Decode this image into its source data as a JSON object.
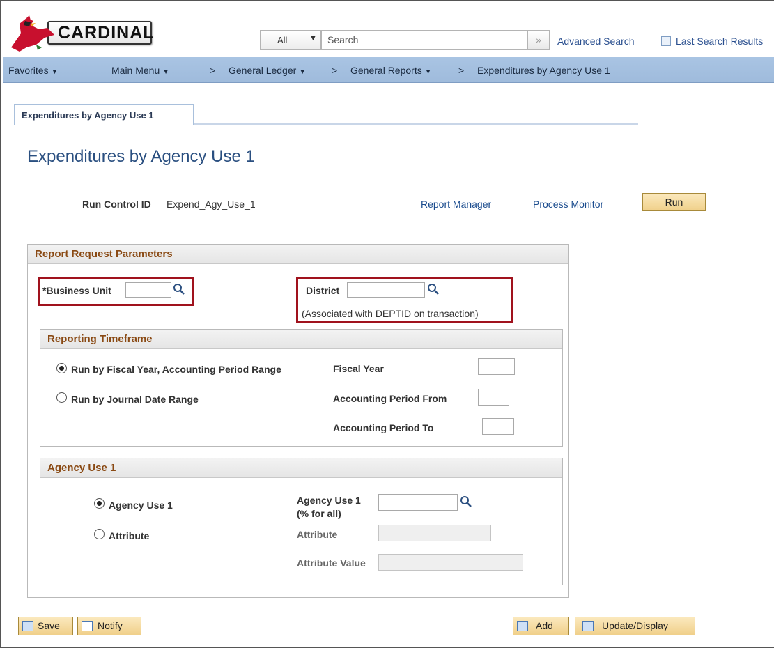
{
  "header": {
    "logo_text": "CARDINAL",
    "search_scope": "All",
    "search_placeholder": "Search",
    "advanced_search": "Advanced Search",
    "last_search_results": "Last Search Results"
  },
  "nav": {
    "favorites": "Favorites",
    "main_menu": "Main Menu",
    "crumbs": [
      "General Ledger",
      "General Reports",
      "Expenditures by Agency Use 1"
    ],
    "separator": ">"
  },
  "tab": {
    "label": "Expenditures by Agency Use 1"
  },
  "page": {
    "title": "Expenditures by Agency Use 1",
    "run_control_label": "Run Control ID",
    "run_control_value": "Expend_Agy_Use_1",
    "report_manager": "Report Manager",
    "process_monitor": "Process Monitor",
    "run": "Run"
  },
  "params": {
    "heading": "Report Request Parameters",
    "business_unit_label": "*Business Unit",
    "business_unit_value": "",
    "district_label": "District",
    "district_value": "",
    "district_note": "(Associated with DEPTID on transaction)"
  },
  "timeframe": {
    "heading": "Reporting Timeframe",
    "option_fiscal": "Run by Fiscal Year, Accounting Period Range",
    "option_journal": "Run by Journal Date Range",
    "selected": "fiscal",
    "fiscal_year_label": "Fiscal Year",
    "period_from_label": "Accounting Period From",
    "period_to_label": "Accounting Period To"
  },
  "agency": {
    "heading": "Agency Use 1",
    "option_agency": "Agency Use 1",
    "option_attribute": "Attribute",
    "selected": "agency",
    "agency_field_label": "Agency Use 1",
    "agency_field_hint": "(% for all)",
    "attribute_label": "Attribute",
    "attribute_value_label": "Attribute Value"
  },
  "footer": {
    "save": "Save",
    "notify": "Notify",
    "add": "Add",
    "update_display": "Update/Display"
  },
  "colors": {
    "nav_bg": "#a9c4e3",
    "section_heading": "#8a4a14",
    "highlight_border": "#a0121d",
    "button_bg": "#f0d08a"
  }
}
